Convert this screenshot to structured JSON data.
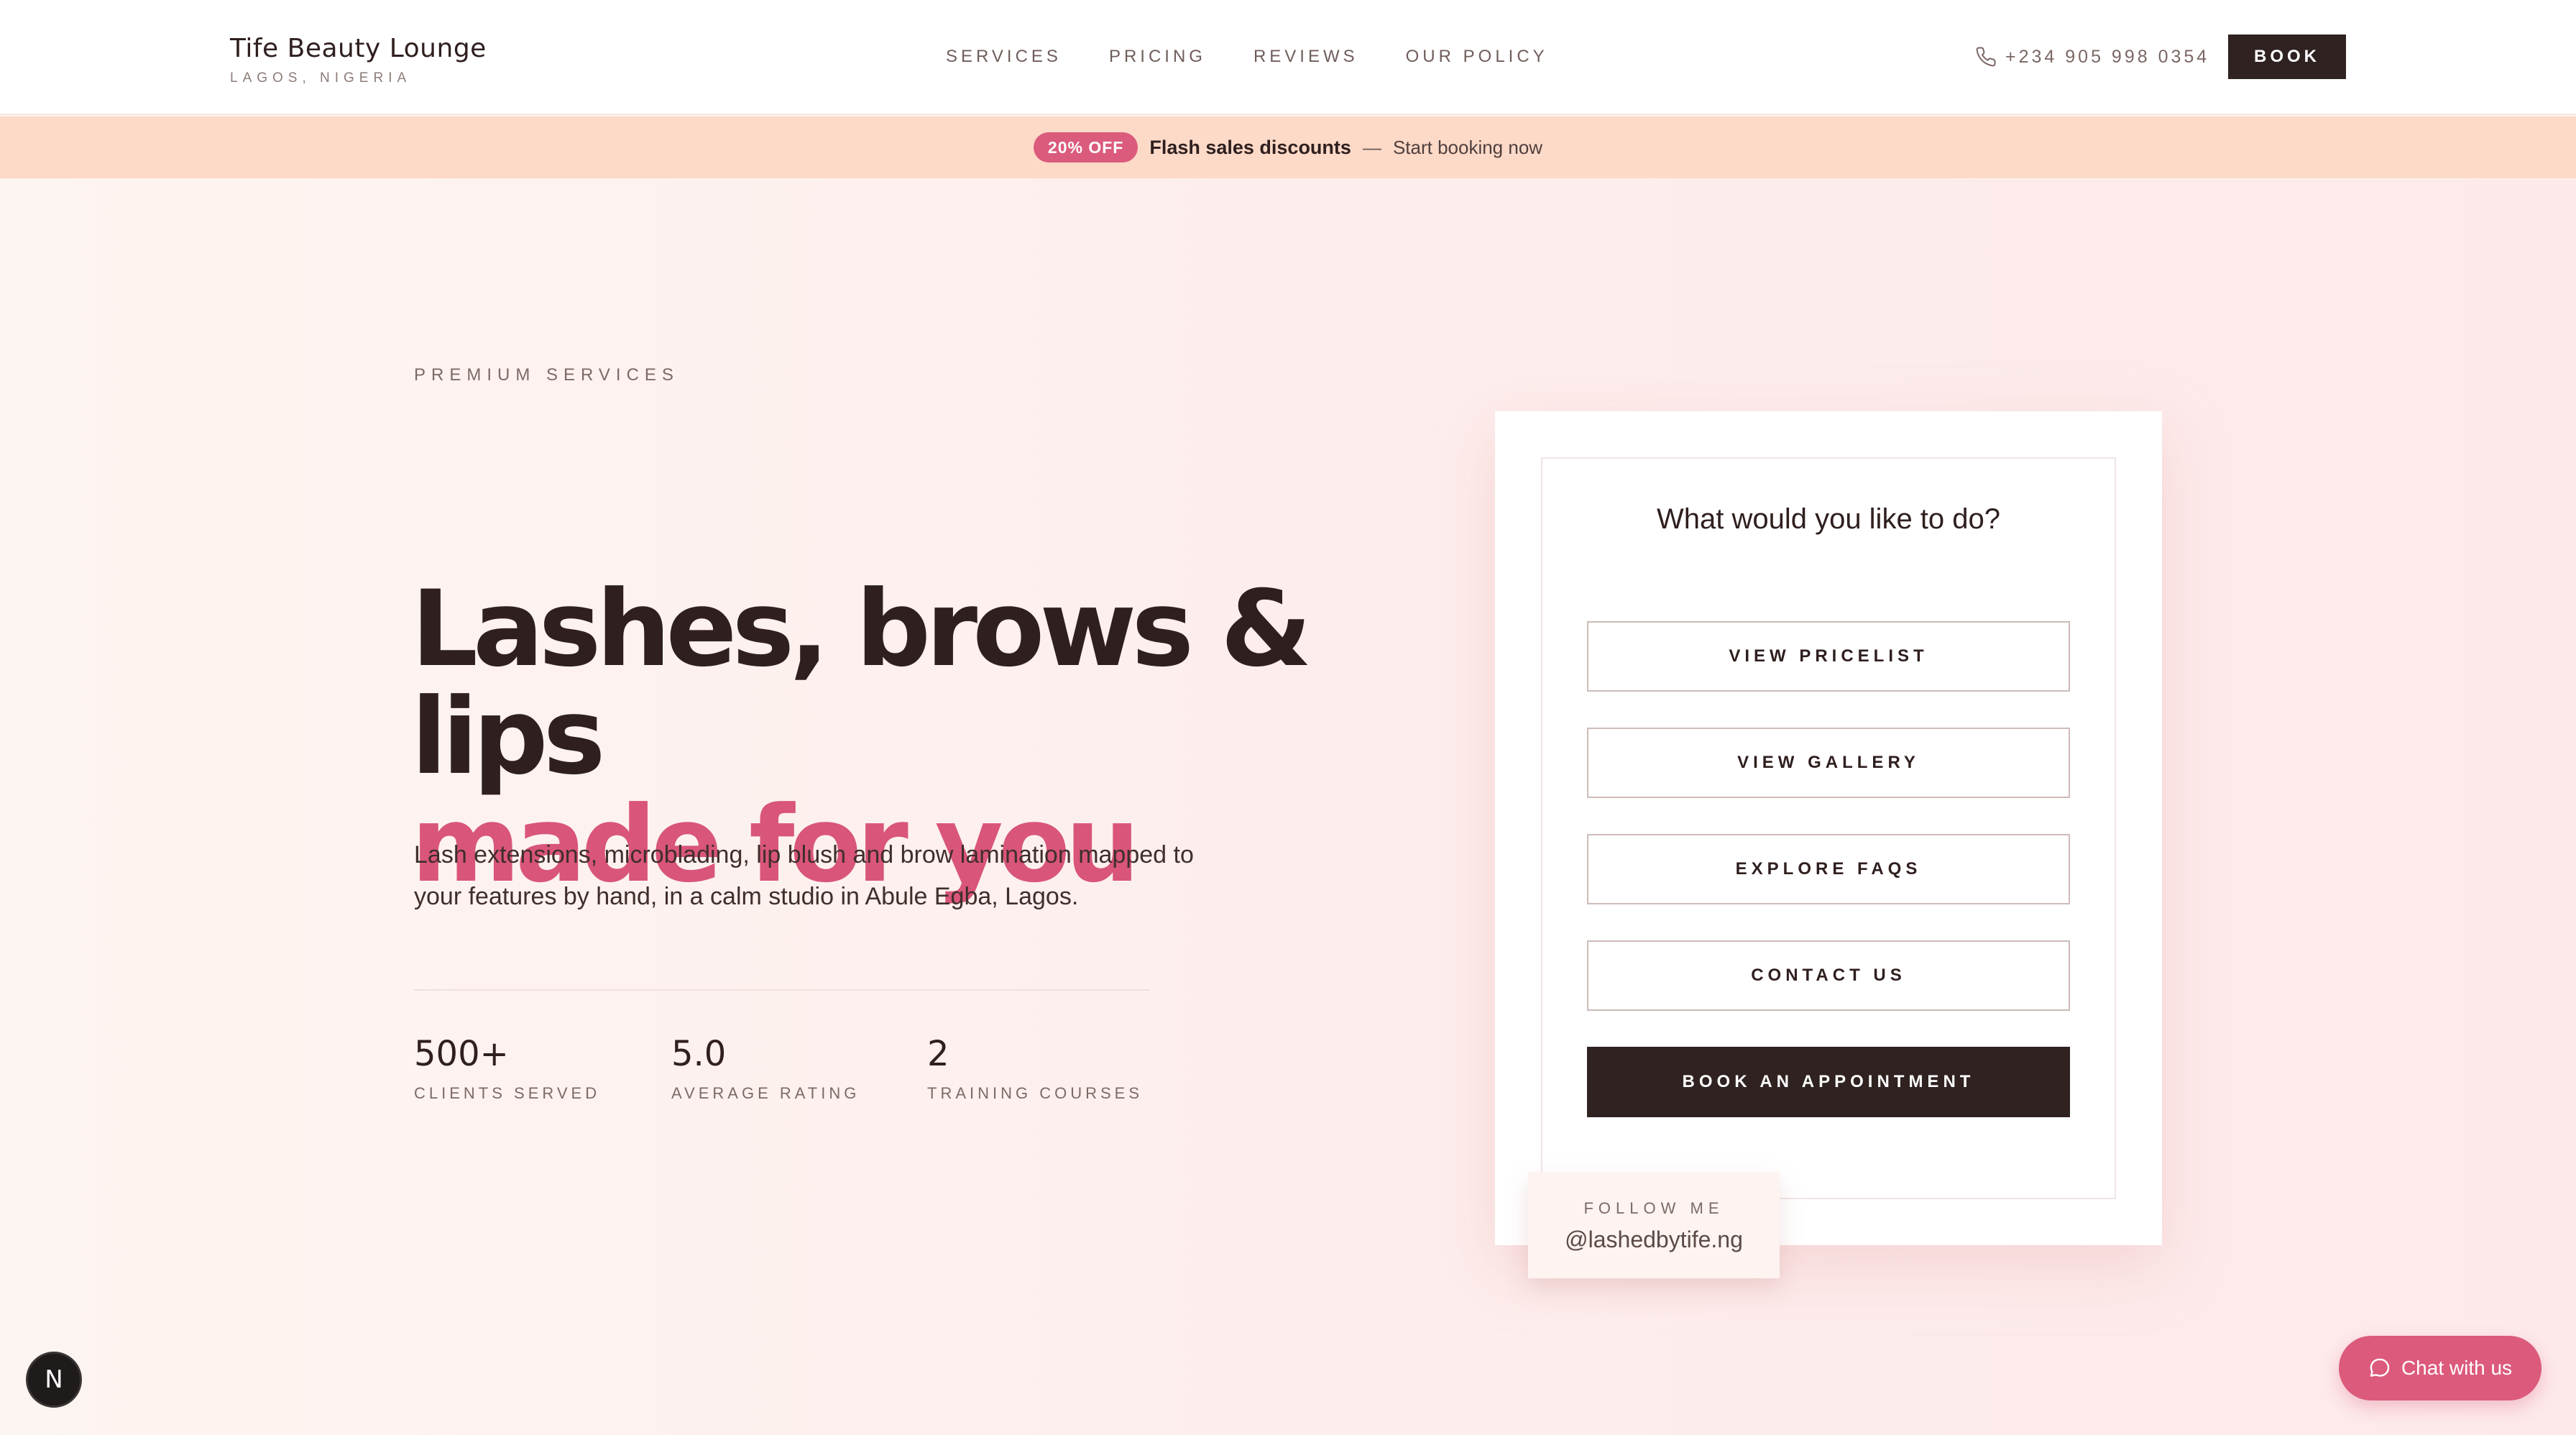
{
  "header": {
    "brand_name": "Tife Beauty Lounge",
    "brand_location": "LAGOS, NIGERIA",
    "nav": [
      "SERVICES",
      "PRICING",
      "REVIEWS",
      "OUR POLICY"
    ],
    "phone": "+234 905 998 0354",
    "book_label": "BOOK"
  },
  "promo": {
    "badge": "20% OFF",
    "title": "Flash sales discounts",
    "separator": "—",
    "subtitle": "Start booking now"
  },
  "hero": {
    "eyebrow": "PREMIUM SERVICES",
    "headline_line1": "Lashes, brows & lips",
    "headline_line2": "made for you",
    "intro": "Lash extensions, microblading, lip blush and brow lamination mapped to your features by hand, in a calm studio in Abule Egba, Lagos.",
    "stats": [
      {
        "value": "500+",
        "label": "CLIENTS SERVED"
      },
      {
        "value": "5.0",
        "label": "AVERAGE RATING"
      },
      {
        "value": "2",
        "label": "TRAINING COURSES"
      }
    ]
  },
  "card": {
    "title": "What would you like to do?",
    "buttons": [
      "VIEW PRICELIST",
      "VIEW GALLERY",
      "EXPLORE FAQS",
      "CONTACT US"
    ],
    "primary_button": "BOOK AN APPOINTMENT",
    "follow_label": "FOLLOW ME",
    "follow_handle": "@lashedbytife.ng"
  },
  "floating": {
    "dev_badge": "N",
    "chat_label": "Chat with us"
  },
  "colors": {
    "accent_pink": "#d9557a",
    "dark": "#2f2220",
    "promo_bg": "#fdd9c8"
  }
}
